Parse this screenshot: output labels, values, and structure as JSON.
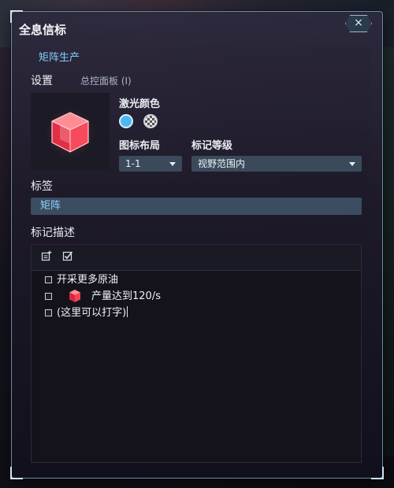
{
  "window": {
    "title": "全息信标",
    "close_label": "×",
    "subtitle": "矩阵生产"
  },
  "settings": {
    "section_label": "设置",
    "master_panel_label": "总控面板 (I)",
    "laser_color_label": "激光颜色",
    "laser_color": "#4fb7f0",
    "icon_layout_label": "图标布局",
    "icon_layout_value": "1-1",
    "mark_level_label": "标记等级",
    "mark_level_value": "视野范围内"
  },
  "tag": {
    "label": "标签",
    "value": "矩阵"
  },
  "description": {
    "label": "标记描述",
    "toolbar": {
      "insert_icon": "insert-icon",
      "checkbox_icon": "checkbox-icon"
    },
    "lines": [
      {
        "text": "开采更多原油",
        "checked": false
      },
      {
        "text": "产量达到120/s",
        "checked": false,
        "icon": "matrix-cube-icon"
      },
      {
        "text": "(这里可以打字)",
        "checked": false
      }
    ]
  }
}
